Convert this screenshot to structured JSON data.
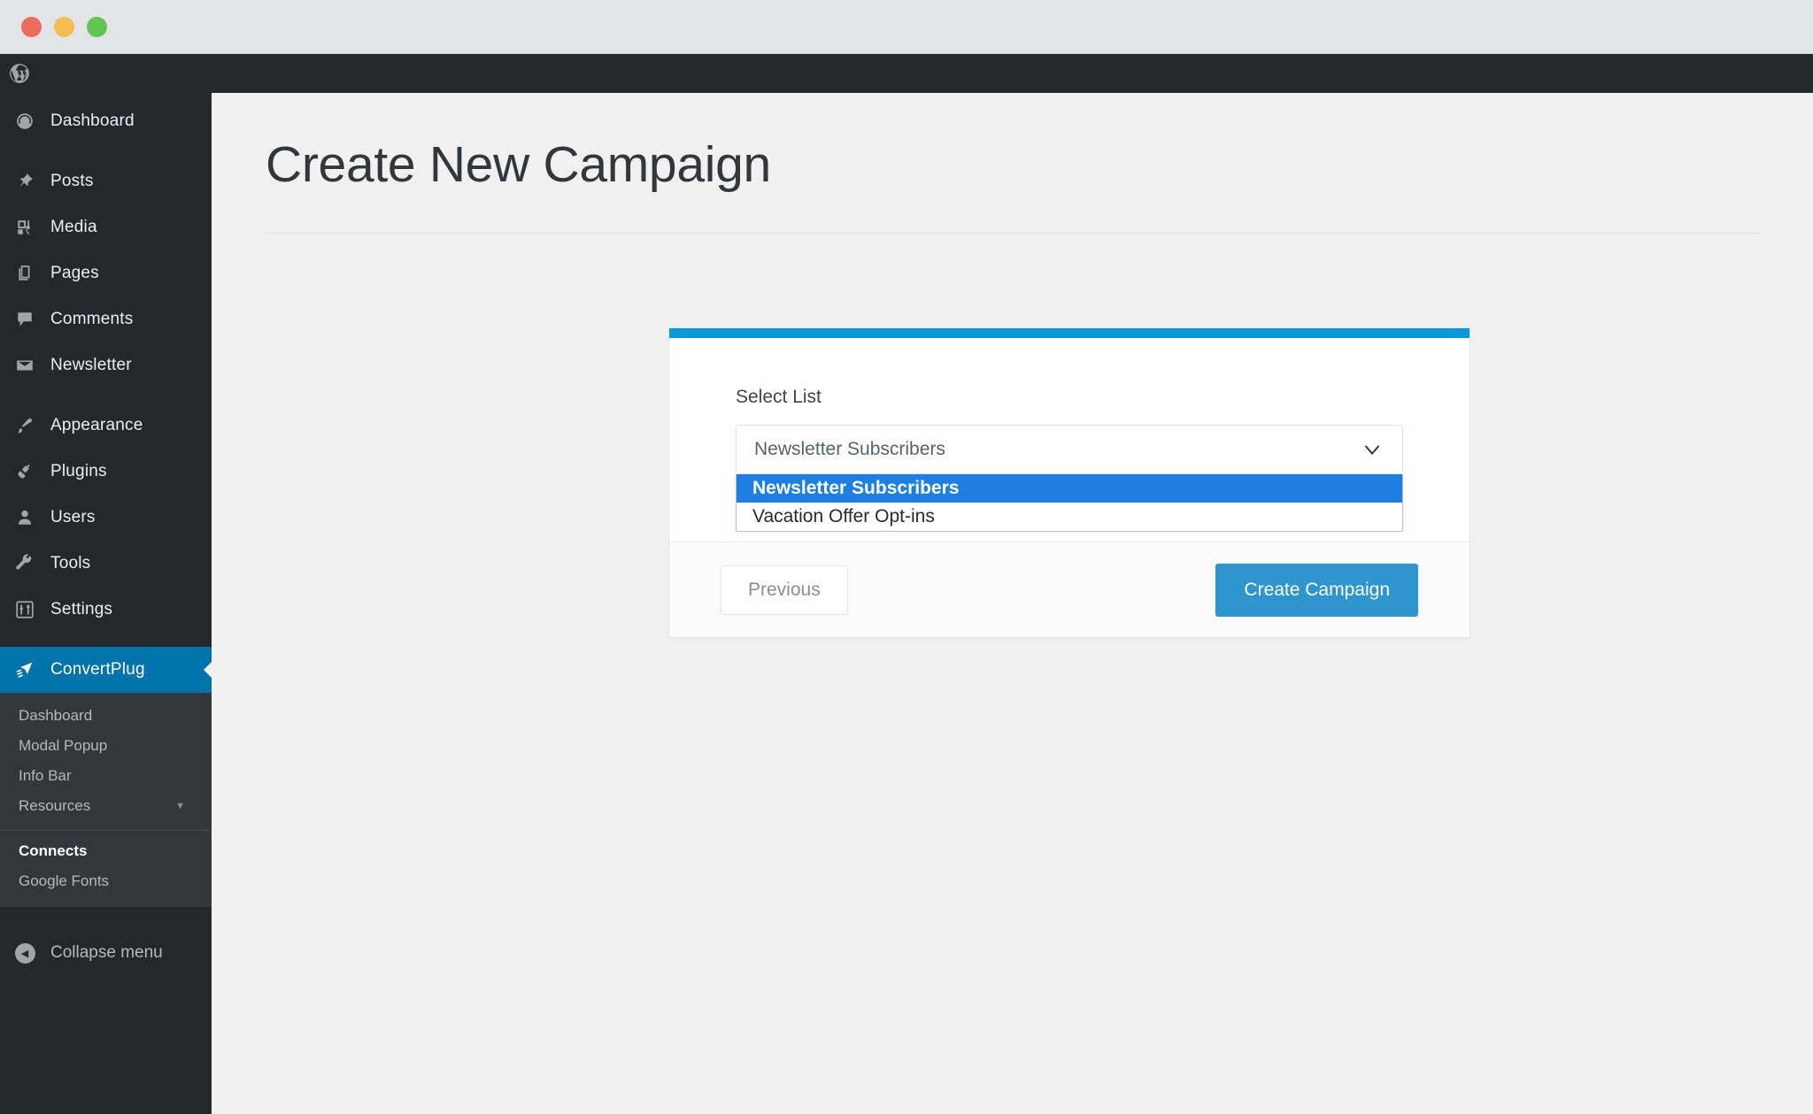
{
  "window": {
    "traffic_lights": [
      "close",
      "minimize",
      "zoom"
    ],
    "colors": {
      "close": "#ed6a5e",
      "minimize": "#f5bd4f",
      "zoom": "#61c554"
    }
  },
  "adminbar": {
    "logo": "wordpress-logo"
  },
  "sidebar": {
    "items": [
      {
        "label": "Dashboard",
        "icon": "dashboard-icon"
      },
      {
        "label": "Posts",
        "icon": "pin-icon"
      },
      {
        "label": "Media",
        "icon": "media-icon"
      },
      {
        "label": "Pages",
        "icon": "pages-icon"
      },
      {
        "label": "Comments",
        "icon": "comment-icon"
      },
      {
        "label": "Newsletter",
        "icon": "envelope-icon"
      },
      {
        "label": "Appearance",
        "icon": "brush-icon"
      },
      {
        "label": "Plugins",
        "icon": "plug-icon"
      },
      {
        "label": "Users",
        "icon": "user-icon"
      },
      {
        "label": "Tools",
        "icon": "wrench-icon"
      },
      {
        "label": "Settings",
        "icon": "sliders-icon"
      },
      {
        "label": "ConvertPlug",
        "icon": "convertplug-icon",
        "active": true
      }
    ],
    "submenu": [
      {
        "label": "Dashboard"
      },
      {
        "label": "Modal Popup"
      },
      {
        "label": "Info Bar"
      },
      {
        "label": "Resources",
        "caret": "▼"
      },
      {
        "label": "Connects",
        "current": true
      },
      {
        "label": "Google Fonts"
      }
    ],
    "collapse": {
      "label": "Collapse menu",
      "icon": "collapse-arrow-icon",
      "glyph": "◀"
    },
    "active_color": "#0073aa"
  },
  "main": {
    "page_title": "Create New Campaign"
  },
  "card": {
    "accent_color": "#0d96da",
    "field_label": "Select List",
    "select": {
      "value": "Newsletter Subscribers",
      "chevron": "chevron-down-icon",
      "options": [
        {
          "label": "Newsletter Subscribers",
          "selected": true
        },
        {
          "label": "Vacation Offer Opt-ins",
          "selected": false
        }
      ],
      "highlight_color": "#1e7fe0"
    },
    "footer": {
      "previous_label": "Previous",
      "create_label": "Create Campaign",
      "create_color": "#2f95ce"
    }
  }
}
